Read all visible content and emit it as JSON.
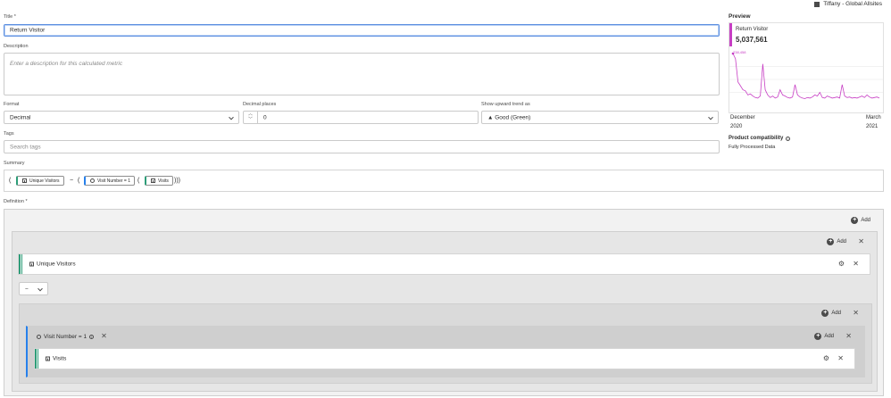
{
  "org": {
    "name": "Tiffany - Global Allsites",
    "icon": "building-icon"
  },
  "title": {
    "label": "Title",
    "required_mark": "*",
    "value": "Return Visitor"
  },
  "description": {
    "label": "Description",
    "placeholder": "Enter a description for this calculated metric"
  },
  "format": {
    "label": "Format",
    "value": "Decimal"
  },
  "decimal_places": {
    "label": "Decimal places",
    "value": "0"
  },
  "trend": {
    "label": "Show upward trend as",
    "value": "▲ Good (Green)"
  },
  "tags": {
    "label": "Tags",
    "placeholder": "Search tags"
  },
  "summary": {
    "label": "Summary",
    "open1": "(",
    "chip1": "Unique Visitors",
    "op": "−",
    "open2": "(",
    "chip2": "Visit Number = 1",
    "open3": "(",
    "chip3": "Visits",
    "close": ")))"
  },
  "preview": {
    "label": "Preview",
    "metric_name": "Return Visitor",
    "metric_value": "5,037,561",
    "peak_label": "238,458",
    "x_start_month": "December",
    "x_start_year": "2020",
    "x_end_month": "March",
    "x_end_year": "2021",
    "accent": "#c73ec4"
  },
  "chart_data": {
    "type": "line",
    "series": [
      {
        "values": [
          238458,
          90,
          45,
          38,
          30,
          28,
          20,
          22,
          18,
          15,
          14,
          18,
          80,
          30,
          20,
          15,
          18,
          14,
          16,
          30,
          20,
          18,
          15,
          14,
          16,
          40,
          20,
          16,
          14,
          13,
          15,
          14,
          16,
          20,
          18,
          25,
          15,
          14,
          18,
          16,
          14,
          15,
          16,
          14,
          40,
          18,
          15,
          16,
          14,
          15,
          14,
          16,
          18,
          15,
          20,
          16,
          14,
          15,
          16,
          14
        ]
      }
    ]
  },
  "compat": {
    "label": "Product compatibility",
    "value": "Fully Processed Data"
  },
  "definition": {
    "label": "Definition",
    "required_mark": "*",
    "add_label": "Add",
    "metric1": "Unique Visitors",
    "operator": "−",
    "segment": "Visit Number = 1",
    "metric2": "Visits"
  },
  "colors": {
    "green": "#2d9d78",
    "blue": "#2680eb",
    "focus": "#5c8fe0"
  }
}
